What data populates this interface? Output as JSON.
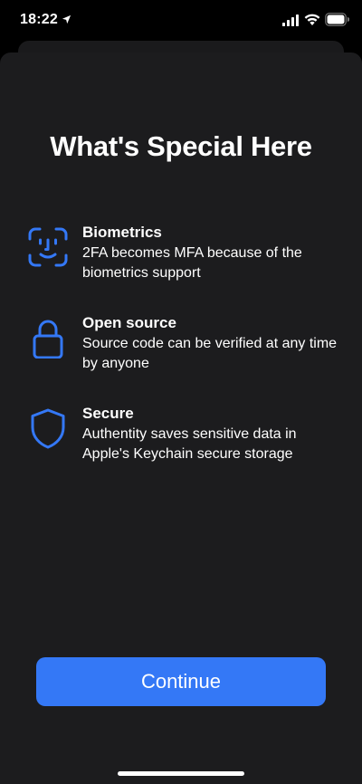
{
  "status_bar": {
    "time": "18:22",
    "icons": [
      "location-arrow-icon",
      "cellular-signal-icon",
      "wifi-icon",
      "battery-icon"
    ]
  },
  "screen": {
    "title": "What's Special Here"
  },
  "features": [
    {
      "icon": "face-id-icon",
      "title": "Biometrics",
      "description": "2FA becomes MFA because of the biometrics support"
    },
    {
      "icon": "lock-icon",
      "title": "Open source",
      "description": "Source code can be verified at any time by anyone"
    },
    {
      "icon": "shield-icon",
      "title": "Secure",
      "description": "Authentity saves sensitive data in Apple's Keychain secure storage"
    }
  ],
  "continue_button": {
    "label": "Continue"
  },
  "colors": {
    "accent": "#3478f6",
    "background": "#000000",
    "sheet": "#1c1c1e",
    "text": "#ffffff"
  }
}
